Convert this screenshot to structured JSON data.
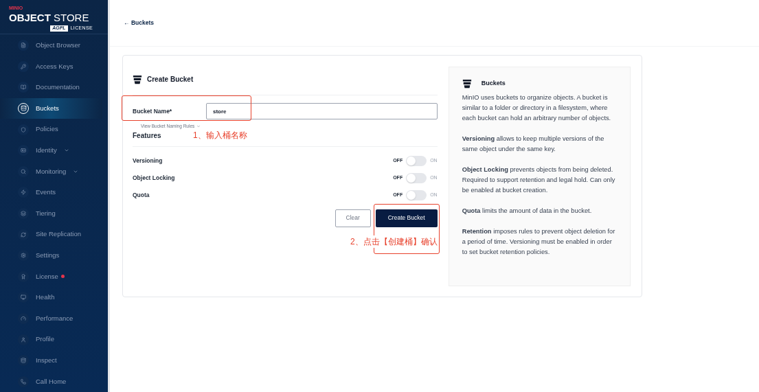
{
  "sidebar": {
    "logo": {
      "brand": "MINIO",
      "product_bold": "OBJECT",
      "product": "STORE",
      "badge": "AGPL",
      "license": "LICENSE"
    },
    "items": [
      {
        "label": "Object Browser",
        "selected": false,
        "submenu": false,
        "alert": false
      },
      {
        "label": "Access Keys",
        "selected": false,
        "submenu": false,
        "alert": false
      },
      {
        "label": "Documentation",
        "selected": false,
        "submenu": false,
        "alert": false
      },
      {
        "label": "Buckets",
        "selected": true,
        "submenu": false,
        "alert": false
      },
      {
        "label": "Policies",
        "selected": false,
        "submenu": false,
        "alert": false
      },
      {
        "label": "Identity",
        "selected": false,
        "submenu": true,
        "alert": false
      },
      {
        "label": "Monitoring",
        "selected": false,
        "submenu": true,
        "alert": false
      },
      {
        "label": "Events",
        "selected": false,
        "submenu": false,
        "alert": false
      },
      {
        "label": "Tiering",
        "selected": false,
        "submenu": false,
        "alert": false
      },
      {
        "label": "Site Replication",
        "selected": false,
        "submenu": false,
        "alert": false
      },
      {
        "label": "Settings",
        "selected": false,
        "submenu": false,
        "alert": false
      },
      {
        "label": "License",
        "selected": false,
        "submenu": false,
        "alert": true
      },
      {
        "label": "Health",
        "selected": false,
        "submenu": false,
        "alert": false
      },
      {
        "label": "Performance",
        "selected": false,
        "submenu": false,
        "alert": false
      },
      {
        "label": "Profile",
        "selected": false,
        "submenu": false,
        "alert": false
      },
      {
        "label": "Inspect",
        "selected": false,
        "submenu": false,
        "alert": false
      },
      {
        "label": "Call Home",
        "selected": false,
        "submenu": false,
        "alert": false
      }
    ]
  },
  "breadcrumb": {
    "arrow": "←",
    "label": "Buckets"
  },
  "form": {
    "title": "Create Bucket",
    "name_label": "Bucket Name*",
    "name_value": "store",
    "rules_link": "View Bucket Naming Rules",
    "features_title": "Features",
    "features": [
      {
        "label": "Versioning",
        "off_label": "OFF",
        "on_label": "ON",
        "on": false
      },
      {
        "label": "Object Locking",
        "off_label": "OFF",
        "on_label": "ON",
        "on": false
      },
      {
        "label": "Quota",
        "off_label": "OFF",
        "on_label": "ON",
        "on": false
      }
    ],
    "buttons": {
      "clear": "Clear",
      "create": "Create Bucket"
    }
  },
  "help": {
    "title": "Buckets",
    "paragraphs": [
      "MinIO uses buckets to organize objects. A bucket is similar to a folder or directory in a filesystem, where each bucket can hold an arbitrary number of objects.",
      "**Versioning** allows to keep multiple versions of the same object under the same key.",
      "**Object Locking** prevents objects from being deleted. Required to support retention and legal hold. Can only be enabled at bucket creation.",
      "**Quota** limits the amount of data in the bucket.",
      "**Retention** imposes rules to prevent object deletion for a period of time. Versioning must be enabled in order to set bucket retention policies."
    ]
  },
  "annotations": [
    "1、输入桶名称",
    "2、点击【创建桶】确认"
  ]
}
